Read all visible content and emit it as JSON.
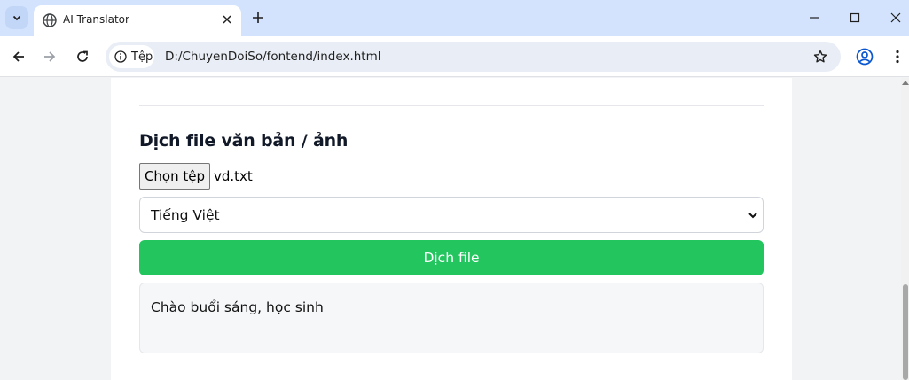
{
  "browser": {
    "tab": {
      "title": "AI Translator",
      "favicon": "globe-icon"
    },
    "address": {
      "chip_label": "Tệp",
      "url": "D:/ChuyenDoiSo/fontend/index.html"
    },
    "icons": {
      "tab_list": "chevron-down-icon",
      "close_tab": "close-icon",
      "new_tab": "plus-icon",
      "minimize": "minimize-icon",
      "maximize": "maximize-icon",
      "close_window": "close-icon",
      "back": "arrow-left-icon",
      "forward": "arrow-right-icon",
      "reload": "reload-icon",
      "site_info": "info-icon",
      "bookmark": "star-icon",
      "profile": "profile-icon",
      "menu": "more-vert-icon"
    }
  },
  "page": {
    "section_title": "Dịch file văn bản / ảnh",
    "file_input": {
      "button_label": "Chọn tệp",
      "file_name": "vd.txt"
    },
    "language_select": {
      "selected": "Tiếng Việt"
    },
    "translate_button_label": "Dịch file",
    "output_text": "Chào buổi sáng, học sinh"
  },
  "colors": {
    "tabstrip_bg": "#d3e3fd",
    "accent_button": "#22c55e",
    "page_bg": "#f2f3f5",
    "output_bg": "#f6f7f9"
  }
}
